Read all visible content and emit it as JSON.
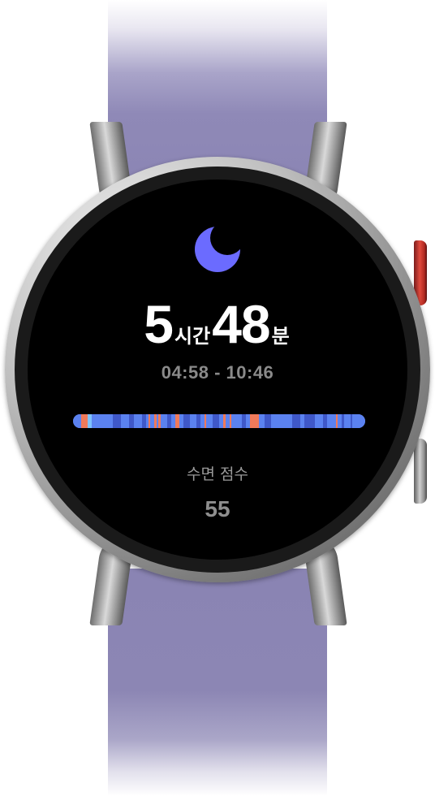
{
  "watch": {
    "strap_color": "#8c86b4",
    "case_color": "#bdbdbd",
    "accent_button_color": "#e04a3d"
  },
  "sleep": {
    "icon": "moon-icon",
    "icon_color": "#6b6bff",
    "hours_value": "5",
    "hours_unit": "시간",
    "minutes_value": "48",
    "minutes_unit": "분",
    "time_range": "04:58 - 10:46",
    "score_label": "수면 점수",
    "score_value": "55"
  },
  "sleep_stages": {
    "colors": {
      "deep": "#3f58c9",
      "light": "#5b82f0",
      "rem": "#7ec3ff",
      "awake": "#f07a5a"
    },
    "segments": [
      {
        "stage": "light",
        "weight": 4
      },
      {
        "stage": "awake",
        "weight": 3
      },
      {
        "stage": "rem",
        "weight": 2
      },
      {
        "stage": "light",
        "weight": 10
      },
      {
        "stage": "deep",
        "weight": 4
      },
      {
        "stage": "light",
        "weight": 4
      },
      {
        "stage": "deep",
        "weight": 2
      },
      {
        "stage": "light",
        "weight": 4
      },
      {
        "stage": "deep",
        "weight": 2
      },
      {
        "stage": "light",
        "weight": 1
      },
      {
        "stage": "awake",
        "weight": 1
      },
      {
        "stage": "light",
        "weight": 2
      },
      {
        "stage": "awake",
        "weight": 1
      },
      {
        "stage": "light",
        "weight": 1
      },
      {
        "stage": "awake",
        "weight": 1
      },
      {
        "stage": "light",
        "weight": 3
      },
      {
        "stage": "deep",
        "weight": 2
      },
      {
        "stage": "light",
        "weight": 2
      },
      {
        "stage": "awake",
        "weight": 2
      },
      {
        "stage": "light",
        "weight": 2
      },
      {
        "stage": "deep",
        "weight": 3
      },
      {
        "stage": "light",
        "weight": 3
      },
      {
        "stage": "deep",
        "weight": 2
      },
      {
        "stage": "light",
        "weight": 2
      },
      {
        "stage": "awake",
        "weight": 1
      },
      {
        "stage": "light",
        "weight": 3
      },
      {
        "stage": "deep",
        "weight": 3
      },
      {
        "stage": "light",
        "weight": 2
      },
      {
        "stage": "awake",
        "weight": 1
      },
      {
        "stage": "light",
        "weight": 2
      },
      {
        "stage": "awake",
        "weight": 1
      },
      {
        "stage": "light",
        "weight": 5
      },
      {
        "stage": "deep",
        "weight": 2
      },
      {
        "stage": "light",
        "weight": 2
      },
      {
        "stage": "awake",
        "weight": 4
      },
      {
        "stage": "light",
        "weight": 3
      },
      {
        "stage": "deep",
        "weight": 3
      },
      {
        "stage": "light",
        "weight": 10
      },
      {
        "stage": "deep",
        "weight": 4
      },
      {
        "stage": "light",
        "weight": 2
      },
      {
        "stage": "deep",
        "weight": 5
      },
      {
        "stage": "light",
        "weight": 4
      },
      {
        "stage": "deep",
        "weight": 2
      },
      {
        "stage": "light",
        "weight": 4
      },
      {
        "stage": "awake",
        "weight": 1
      },
      {
        "stage": "light",
        "weight": 2
      },
      {
        "stage": "deep",
        "weight": 1
      },
      {
        "stage": "light",
        "weight": 3
      },
      {
        "stage": "deep",
        "weight": 1
      },
      {
        "stage": "light",
        "weight": 6
      }
    ]
  }
}
